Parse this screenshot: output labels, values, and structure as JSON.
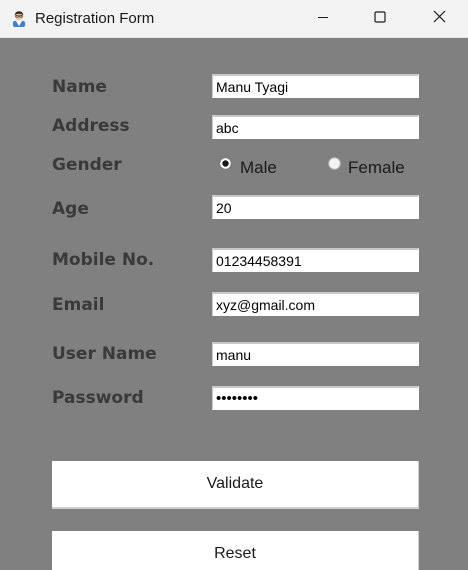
{
  "window": {
    "title": "Registration Form",
    "app_icon": "user-avatar-icon",
    "controls": {
      "minimize": "minimize-icon",
      "maximize": "maximize-icon",
      "close": "close-icon"
    }
  },
  "form": {
    "name": {
      "label": "Name",
      "value": "Manu Tyagi"
    },
    "address": {
      "label": "Address",
      "value": "abc"
    },
    "gender": {
      "label": "Gender",
      "options": [
        {
          "label": "Male",
          "selected": true
        },
        {
          "label": "Female",
          "selected": false
        }
      ]
    },
    "age": {
      "label": "Age",
      "value": "20"
    },
    "mobile": {
      "label": "Mobile No.",
      "value": "01234458391"
    },
    "email": {
      "label": "Email",
      "value": "xyz@gmail.com"
    },
    "username": {
      "label": "User Name",
      "value": "manu"
    },
    "password": {
      "label": "Password",
      "value": "••••••••"
    }
  },
  "buttons": {
    "validate": "Validate",
    "reset": "Reset"
  },
  "colors": {
    "background": "#808080",
    "label": "#3a3a3a",
    "titlebar": "#f3f3f3"
  }
}
